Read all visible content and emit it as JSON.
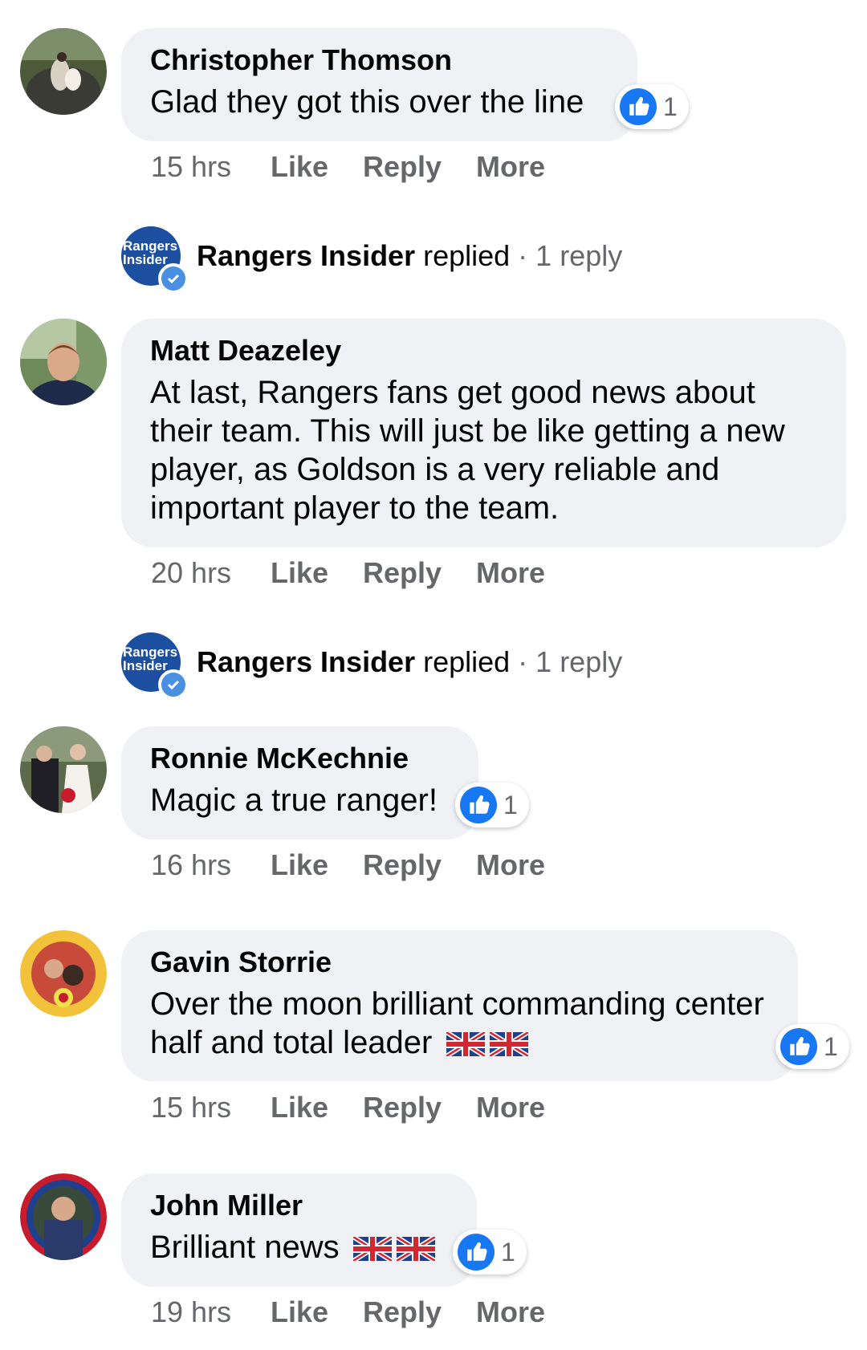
{
  "colors": {
    "bubble": "#eff1f4",
    "secondary_text": "#65676b",
    "like_blue": "#1877f2",
    "page_blue": "#1c4fa0"
  },
  "comments": [
    {
      "author": "Christopher Thomson",
      "text": "Glad they got this over the line",
      "reaction_count": "1",
      "time": "15 hrs",
      "like": "Like",
      "reply": "Reply",
      "more": "More"
    },
    {
      "author": "Matt Deazeley",
      "text": "At last, Rangers fans get good news about their team. This will just be like getting a new player, as Goldson is a very reliable and important player to the team.",
      "time": "20 hrs",
      "like": "Like",
      "reply": "Reply",
      "more": "More"
    },
    {
      "author": "Ronnie McKechnie",
      "text": "Magic a true ranger!",
      "reaction_count": "1",
      "time": "16 hrs",
      "like": "Like",
      "reply": "Reply",
      "more": "More"
    },
    {
      "author": "Gavin Storrie",
      "text": "Over the moon brilliant commanding center half and total leader",
      "reaction_count": "1",
      "time": "15 hrs",
      "like": "Like",
      "reply": "Reply",
      "more": "More"
    },
    {
      "author": "John Miller",
      "text": "Brilliant news",
      "reaction_count": "1",
      "time": "19 hrs",
      "like": "Like",
      "reply": "Reply",
      "more": "More"
    }
  ],
  "replies": [
    {
      "avatar_text": "Rangers Insider",
      "name": "Rangers Insider",
      "word": "replied",
      "separator": "·",
      "count": "1 reply"
    },
    {
      "avatar_text": "Rangers Insider",
      "name": "Rangers Insider",
      "word": "replied",
      "separator": "·",
      "count": "1 reply"
    }
  ],
  "icons": {
    "like": "thumbs-up-icon",
    "verified": "verified-check-icon",
    "flag": "union-jack-flag-icon"
  }
}
